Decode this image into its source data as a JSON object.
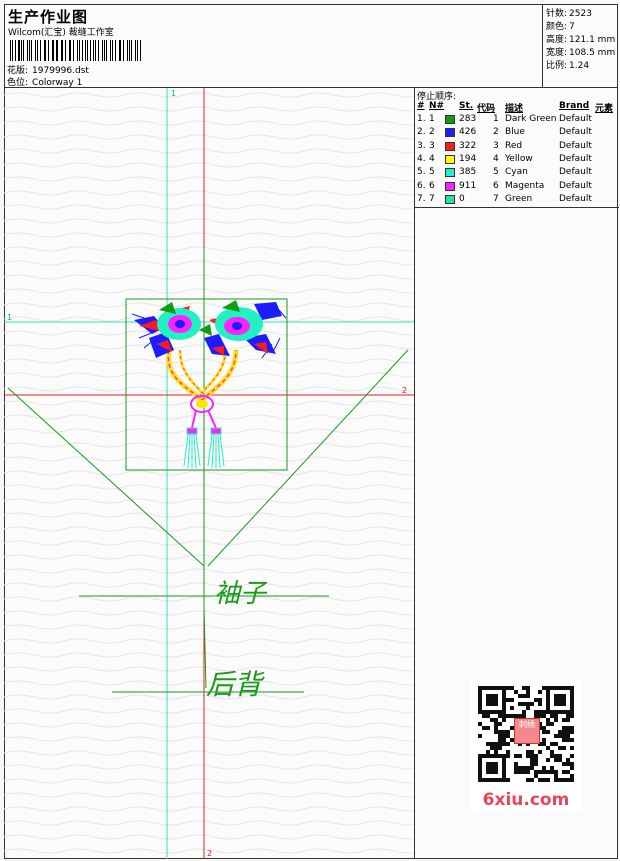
{
  "header": {
    "title": "生产作业图",
    "subtitle": "Wilcom(汇宝) 裁缝工作室",
    "design_file_label": "花版:",
    "design_file": "1979996.dst",
    "colorway_label": "色位:",
    "colorway": "Colorway 1"
  },
  "info": {
    "stitches_label": "针数:",
    "stitches": "2523",
    "colors_label": "颜色:",
    "colors": "7",
    "height_label": "高度:",
    "height": "121.1 mm",
    "width_label": "宽度:",
    "width": "108.5 mm",
    "scale_label": "比例:",
    "scale": "1.24"
  },
  "stop_sequence": {
    "title": "停止顺序:",
    "columns": [
      "#",
      "N#",
      "St.",
      "代码",
      "描述",
      "Brand",
      "元素"
    ],
    "rows": [
      {
        "idx": "1.",
        "n": "1",
        "color": "#139a13",
        "st": "283",
        "code": "1",
        "desc": "Dark Green",
        "brand": "Default"
      },
      {
        "idx": "2.",
        "n": "2",
        "color": "#1c1cff",
        "st": "426",
        "code": "2",
        "desc": "Blue",
        "brand": "Default"
      },
      {
        "idx": "3.",
        "n": "3",
        "color": "#ff1a1a",
        "st": "322",
        "code": "3",
        "desc": "Red",
        "brand": "Default"
      },
      {
        "idx": "4.",
        "n": "4",
        "color": "#ffff00",
        "st": "194",
        "code": "4",
        "desc": "Yellow",
        "brand": "Default"
      },
      {
        "idx": "5.",
        "n": "5",
        "color": "#22f2c2",
        "st": "385",
        "code": "5",
        "desc": "Cyan",
        "brand": "Default"
      },
      {
        "idx": "6.",
        "n": "6",
        "color": "#ff22ff",
        "st": "911",
        "code": "6",
        "desc": "Magenta",
        "brand": "Default"
      },
      {
        "idx": "7.",
        "n": "7",
        "color": "#2ae2a8",
        "st": "0",
        "code": "7",
        "desc": "Green",
        "brand": "Default"
      }
    ]
  },
  "guides": {
    "v1_label": "1",
    "h1_label": "1",
    "h2_label": "2",
    "v2_label": "2"
  },
  "annotations": {
    "sleeve": "袖子",
    "back": "后背"
  },
  "watermark": {
    "brand": "6xiu.com",
    "stamp": "刺绣"
  },
  "colors": {
    "guide_cyan": "#2ee6b4",
    "guide_red": "#e02020",
    "outline_green": "#1a9a1a"
  }
}
